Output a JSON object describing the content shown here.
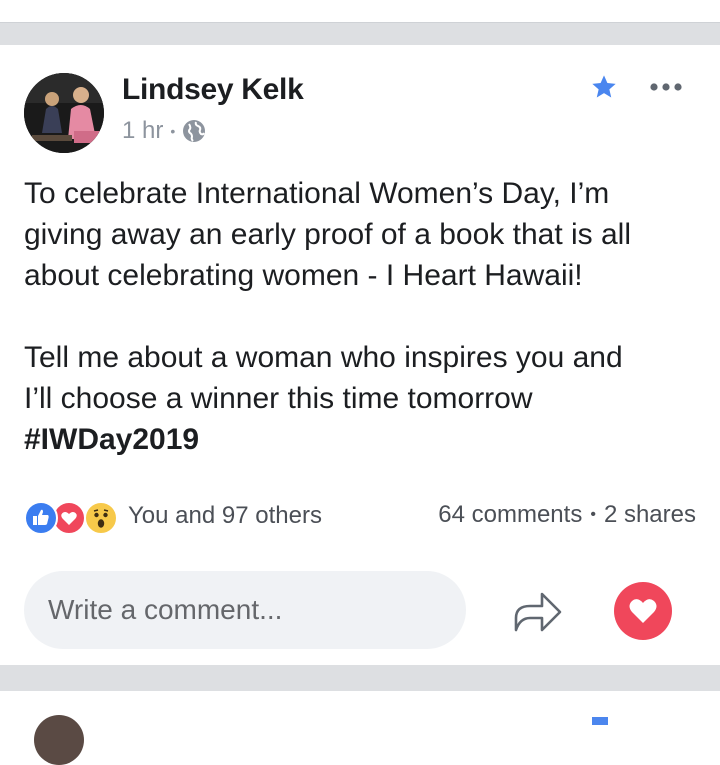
{
  "post": {
    "author": "Lindsey Kelk",
    "timestamp": "1 hr",
    "separator": "•",
    "privacy_icon": "globe-icon",
    "favorite_icon": "star-icon",
    "more_icon": "more-options-icon",
    "text": {
      "line1": "To celebrate International Women’s Day, I’m",
      "line2": "giving away an early proof of a book that is all",
      "line3": "about celebrating women - I Heart Hawaii!",
      "line4": "Tell me about a woman who inspires you and",
      "line5": "I’ll choose a winner this time tomorrow",
      "hashtag": "#IWDay2019"
    },
    "reactions": {
      "icons": [
        "like-icon",
        "love-icon",
        "wow-icon"
      ],
      "summary": "You and 97 others"
    },
    "counts": {
      "comments": "64 comments",
      "bullet": "•",
      "shares": "2 shares"
    },
    "comment": {
      "placeholder": "Write a comment..."
    },
    "actions": {
      "share_icon": "share-arrow-icon",
      "react_icon": "heart-icon"
    }
  },
  "colors": {
    "accent_blue": "#3b7df0",
    "love_red": "#f0475b",
    "wow_yellow": "#f7c94a",
    "separator_gray": "#dddfe2",
    "meta_gray": "#8d949e"
  }
}
